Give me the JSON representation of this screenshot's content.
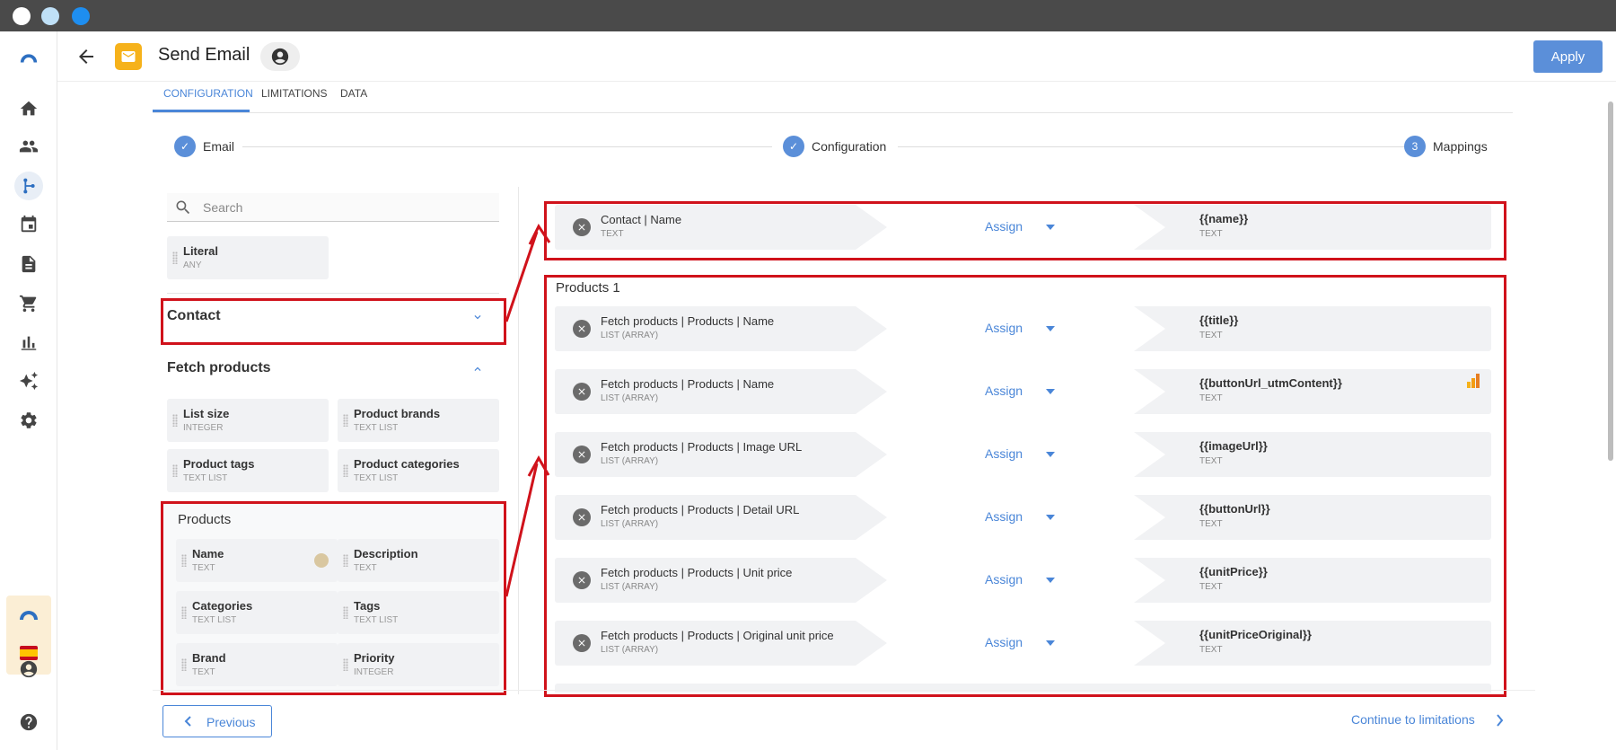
{
  "window": {
    "dots": [
      "#ffffff",
      "#bfe0f7",
      "#1e8ef0"
    ]
  },
  "header": {
    "title": "Send Email",
    "apply_label": "Apply"
  },
  "tabs": [
    {
      "label": "CONFIGURATION",
      "active": true
    },
    {
      "label": "LIMITATIONS",
      "active": false
    },
    {
      "label": "DATA",
      "active": false
    }
  ],
  "steps": [
    {
      "label": "Email",
      "state": "done"
    },
    {
      "label": "Configuration",
      "state": "done"
    },
    {
      "label": "Mappings",
      "number": "3",
      "state": "current"
    }
  ],
  "sources": {
    "search_placeholder": "Search",
    "literal": {
      "name": "Literal",
      "type": "ANY"
    },
    "contact_section": "Contact",
    "fetch_section": "Fetch products",
    "fetch_items": [
      {
        "name": "List size",
        "type": "INTEGER"
      },
      {
        "name": "Product brands",
        "type": "TEXT LIST"
      },
      {
        "name": "Product tags",
        "type": "TEXT LIST"
      },
      {
        "name": "Product categories",
        "type": "TEXT LIST"
      }
    ],
    "products_title": "Products",
    "products_items": [
      {
        "name": "Name",
        "type": "TEXT"
      },
      {
        "name": "Description",
        "type": "TEXT"
      },
      {
        "name": "Categories",
        "type": "TEXT LIST"
      },
      {
        "name": "Tags",
        "type": "TEXT LIST"
      },
      {
        "name": "Brand",
        "type": "TEXT"
      },
      {
        "name": "Priority",
        "type": "INTEGER"
      }
    ]
  },
  "mappings": {
    "assign_label": "Assign",
    "top_row": {
      "source": "Contact | Name",
      "source_type": "TEXT",
      "target": "{{name}}",
      "target_type": "TEXT"
    },
    "group_title": "Products 1",
    "rows": [
      {
        "source": "Fetch products | Products | Name",
        "source_type": "LIST (ARRAY)",
        "target": "{{title}}",
        "target_type": "TEXT"
      },
      {
        "source": "Fetch products | Products | Name",
        "source_type": "LIST (ARRAY)",
        "target": "{{buttonUrl_utmContent}}",
        "target_type": "TEXT"
      },
      {
        "source": "Fetch products | Products | Image URL",
        "source_type": "LIST (ARRAY)",
        "target": "{{imageUrl}}",
        "target_type": "TEXT"
      },
      {
        "source": "Fetch products | Products | Detail URL",
        "source_type": "LIST (ARRAY)",
        "target": "{{buttonUrl}}",
        "target_type": "TEXT"
      },
      {
        "source": "Fetch products | Products | Unit price",
        "source_type": "LIST (ARRAY)",
        "target": "{{unitPrice}}",
        "target_type": "TEXT"
      },
      {
        "source": "Fetch products | Products | Original unit price",
        "source_type": "LIST (ARRAY)",
        "target": "{{unitPriceOriginal}}",
        "target_type": "TEXT"
      }
    ]
  },
  "footer": {
    "previous_label": "Previous",
    "next_label": "Continue to limitations"
  },
  "colors": {
    "accent": "#4a86d8",
    "highlight": "#d0121b"
  }
}
